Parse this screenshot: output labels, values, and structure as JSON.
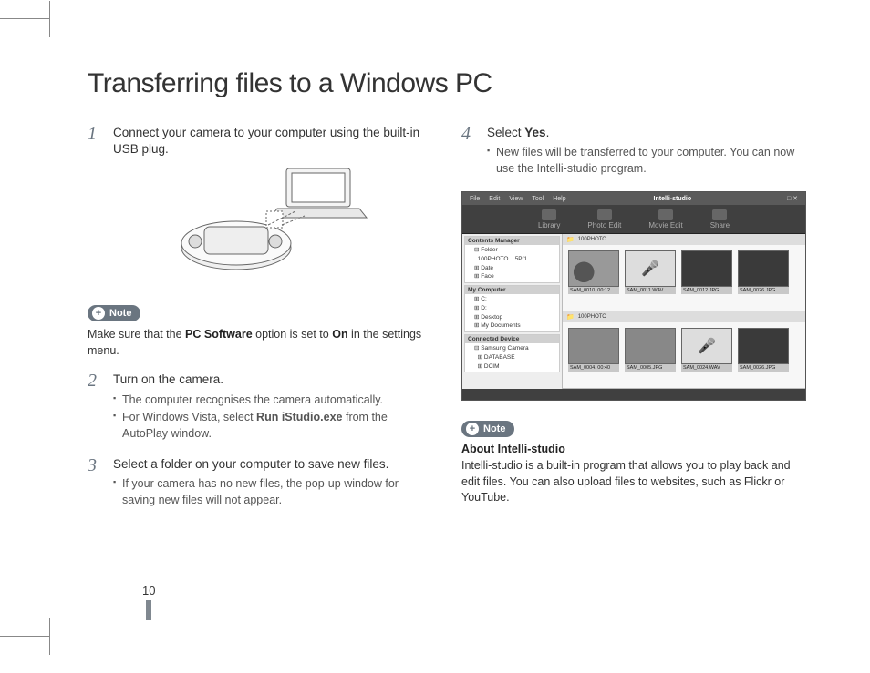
{
  "page_number": "10",
  "title": "Transferring files to a Windows PC",
  "left": {
    "step1": {
      "num": "1",
      "text": "Connect your camera to your computer using the built-in USB plug."
    },
    "note_badge": "Note",
    "note_pre": "Make sure that the ",
    "note_bold1": "PC Software",
    "note_mid": " option is set to ",
    "note_bold2": "On",
    "note_post": " in the settings menu.",
    "step2": {
      "num": "2",
      "head": "Turn on the camera.",
      "b1": "The computer recognises the camera automatically.",
      "b2_pre": "For Windows Vista, select ",
      "b2_bold": "Run iStudio.exe",
      "b2_post": " from the AutoPlay window."
    },
    "step3": {
      "num": "3",
      "head": "Select a folder on your computer to save new files.",
      "b1": "If your camera has no new files, the pop-up window for saving new files will not appear."
    }
  },
  "right": {
    "step4": {
      "num": "4",
      "head_pre": "Select ",
      "head_bold": "Yes",
      "head_post": ".",
      "b1": "New files will be transferred to your computer. You can now use the Intelli-studio program."
    },
    "note_badge": "Note",
    "about_heading": "About Intelli-studio",
    "about_text": "Intelli-studio is a built-in program that allows you to play back and edit files. You can also upload files to websites, such as Flickr or YouTube."
  },
  "screenshot": {
    "app_title": "Intelli-studio",
    "menu": [
      "File",
      "Edit",
      "View",
      "Tool",
      "Help"
    ],
    "toolbar": [
      "Library",
      "Photo Edit",
      "Movie Edit",
      "Share"
    ],
    "sidebar": {
      "contents_manager": "Contents Manager",
      "folder": "Folder",
      "folder_items": [
        "100PHOTO",
        "Date",
        "Face"
      ],
      "my_computer": "My Computer",
      "drives": [
        "C:",
        "D:",
        "Desktop",
        "My Documents"
      ],
      "connected": "Connected Device",
      "device": "Samsung Camera",
      "device_items": [
        "DATABASE",
        "DCIM"
      ]
    },
    "pane1": {
      "header": "100PHOTO",
      "thumbs": [
        "SAM_0010.   00:12",
        "SAM_0011.WAV",
        "SAM_0012.JPG",
        "SAM_0026.JPG"
      ]
    },
    "pane2": {
      "header": "100PHOTO",
      "thumbs": [
        "SAM_0004.   00:40",
        "SAM_0005.JPG",
        "SAM_0024.WAV",
        "SAM_0026.JPG"
      ]
    }
  }
}
